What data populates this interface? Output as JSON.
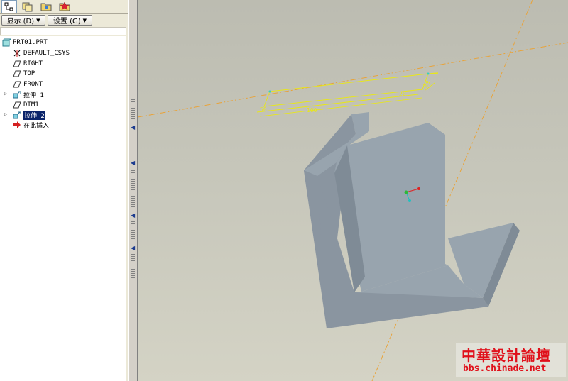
{
  "navigator": {
    "tabs": [
      {
        "icon": "model-tree-icon",
        "selected": true
      },
      {
        "icon": "layers-icon",
        "selected": false
      },
      {
        "icon": "folder-browser-icon",
        "selected": false
      },
      {
        "icon": "favorites-icon",
        "selected": false
      }
    ],
    "show_menu_label": "显示 (D)",
    "settings_menu_label": "设置 (G)"
  },
  "model_tree": {
    "root": {
      "label": "PRT01.PRT",
      "icon": "part-icon"
    },
    "items": [
      {
        "label": "DEFAULT_CSYS",
        "icon": "csys-icon",
        "expandable": false,
        "selected": false
      },
      {
        "label": "RIGHT",
        "icon": "datum-plane-icon",
        "expandable": false,
        "selected": false
      },
      {
        "label": "TOP",
        "icon": "datum-plane-icon",
        "expandable": false,
        "selected": false
      },
      {
        "label": "FRONT",
        "icon": "datum-plane-icon",
        "expandable": false,
        "selected": false
      },
      {
        "label": "拉伸 1",
        "icon": "extrude-icon",
        "expandable": true,
        "selected": false
      },
      {
        "label": "DTM1",
        "icon": "datum-plane-icon",
        "expandable": false,
        "selected": false
      },
      {
        "label": "拉伸 2",
        "icon": "extrude-icon",
        "expandable": true,
        "selected": true
      },
      {
        "label": "在此插入",
        "icon": "insert-here-arrow-icon",
        "expandable": false,
        "selected": false
      }
    ]
  },
  "viewport": {
    "dimensions": [
      "100",
      "20",
      "20",
      "50"
    ],
    "colors": {
      "sketch": "#e8e61a",
      "datum_axis": "#e8a33a",
      "solid_top": "#98a4ae",
      "solid_side": "#7f8b96",
      "solid_front": "#8a95a0"
    }
  },
  "watermark": {
    "title": "中華設計論壇",
    "url": "bbs.chinade.net"
  }
}
